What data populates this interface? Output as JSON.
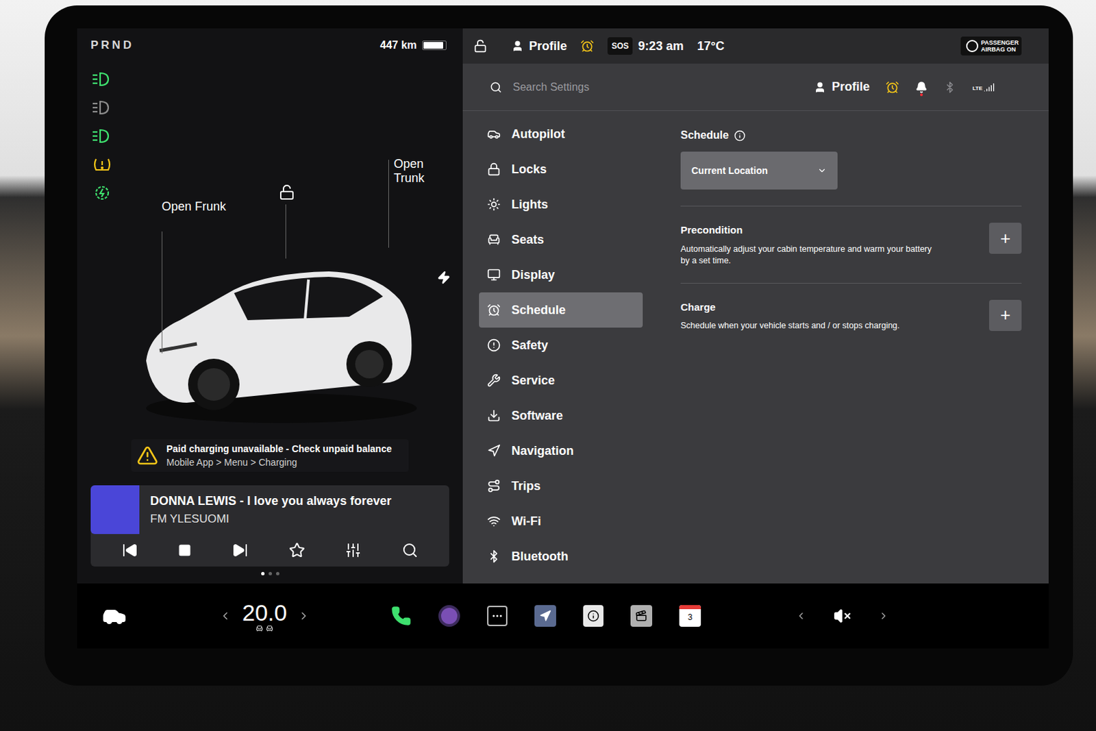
{
  "left_panel": {
    "gear": "PRND",
    "range": "447 km",
    "battery": {
      "level": 0.9
    },
    "indicators": [
      {
        "color": "#3ee06e"
      },
      {
        "color": "#8c8c8c"
      },
      {
        "color": "#3ee06e"
      },
      {
        "color": "#f5c518"
      },
      {
        "color": "#3ee06e"
      }
    ],
    "car_labels": {
      "frunk": "Open Frunk",
      "trunk": "Open Trunk"
    },
    "alert": {
      "title": "Paid charging unavailable - Check unpaid balance",
      "path": "Mobile App > Menu > Charging"
    },
    "media": {
      "title": "DONNA LEWIS - I love you always forever",
      "station": "FM YLESUOMI",
      "pages": [
        {
          "selected": true
        },
        {
          "selected": false
        },
        {
          "selected": false
        }
      ]
    }
  },
  "status_bar": {
    "profile": "Profile",
    "sos": "SOS",
    "time": "9:23 am",
    "temperature": "17°C",
    "airbag": "PASSENGER AIRBAG ON"
  },
  "settings": {
    "search": {
      "placeholder": "Search Settings"
    },
    "profile": "Profile",
    "network": "LTE",
    "bell_alert": true,
    "sidebar": {
      "items": [
        {
          "label": "Autopilot",
          "selected": false
        },
        {
          "label": "Locks",
          "selected": false
        },
        {
          "label": "Lights",
          "selected": false
        },
        {
          "label": "Seats",
          "selected": false
        },
        {
          "label": "Display",
          "selected": false
        },
        {
          "label": "Schedule",
          "selected": true
        },
        {
          "label": "Safety",
          "selected": false
        },
        {
          "label": "Service",
          "selected": false
        },
        {
          "label": "Software",
          "selected": false
        },
        {
          "label": "Navigation",
          "selected": false
        },
        {
          "label": "Trips",
          "selected": false
        },
        {
          "label": "Wi-Fi",
          "selected": false
        },
        {
          "label": "Bluetooth",
          "selected": false
        }
      ]
    },
    "content": {
      "title": "Schedule",
      "location": "Current Location",
      "sections": [
        {
          "title": "Precondition",
          "description": "Automatically adjust your cabin temperature and warm your battery by a set time.",
          "button": "+"
        },
        {
          "title": "Charge",
          "description": "Schedule when your vehicle starts and / or stops charging.",
          "button": "+"
        }
      ]
    }
  },
  "bottom_bar": {
    "temperature": "20.0",
    "calendar_badge": "3",
    "muted": true
  }
}
